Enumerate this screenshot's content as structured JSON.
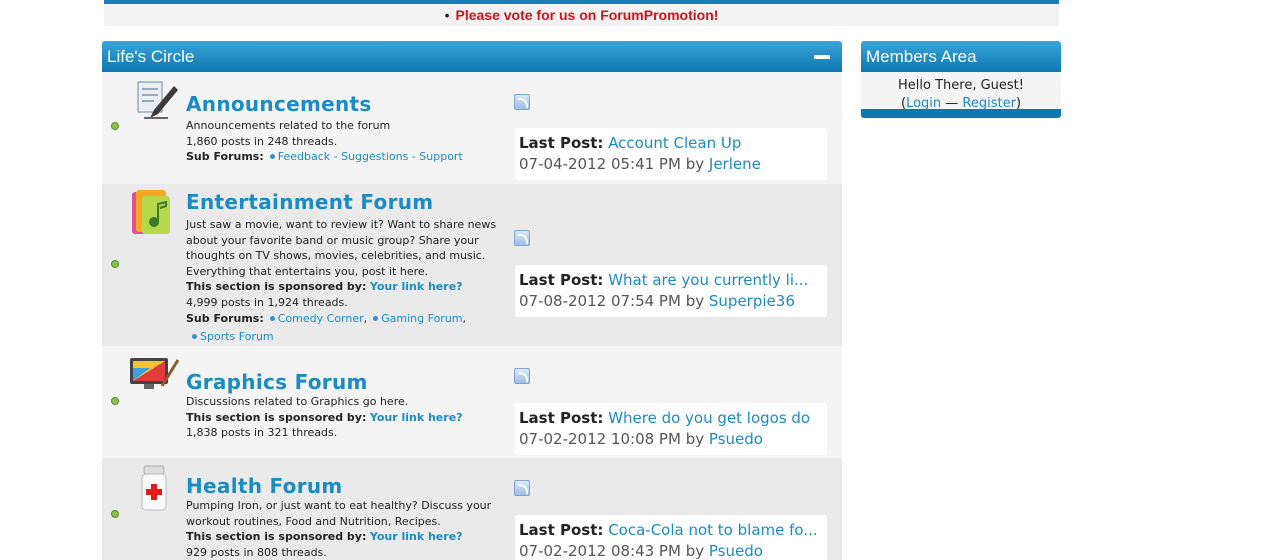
{
  "banner": {
    "bullet": "•",
    "text": "Please vote for us on ForumPromotion!"
  },
  "category": {
    "title": "Life's Circle"
  },
  "members": {
    "title": "Members Area",
    "greeting": "Hello There, Guest!",
    "open": "(",
    "login": "Login",
    "sep": " — ",
    "register": "Register",
    "close": ")"
  },
  "common": {
    "last_post_label": "Last Post:",
    "by": "by",
    "sponsored_label": "This section is sponsored by:",
    "sponsor_link": "Your link here?",
    "sub_forums_label": "Sub Forums:"
  },
  "forums": [
    {
      "title": "Announcements",
      "description": "Announcements related to the forum",
      "stats": "1,860 posts in 248 threads.",
      "sub_forums": "Feedback - Suggestions - Support",
      "last_post": {
        "title": "Account Clean Up",
        "date": "07-04-2012 05:41 PM",
        "author": "Jerlene"
      }
    },
    {
      "title": "Entertainment Forum",
      "description": "Just saw a movie, want to review it? Want to share news about your favorite band or music group? Share your thoughts on TV shows, movies, celebrities, and music. Everything that entertains you, post it here.",
      "stats": "4,999 posts in 1,924 threads.",
      "sub_forums": [
        "Comedy Corner",
        "Gaming Forum",
        "Sports Forum"
      ],
      "last_post": {
        "title": "What are you currently li...",
        "date": "07-08-2012 07:54 PM",
        "author": "Superpie36"
      }
    },
    {
      "title": "Graphics Forum",
      "description": "Discussions related to Graphics go here.",
      "stats": "1,838 posts in 321 threads.",
      "last_post": {
        "title": "Where do you get logos do",
        "date": "07-02-2012 10:08 PM",
        "author": "Psuedo"
      }
    },
    {
      "title": "Health Forum",
      "description": "Pumping Iron, or just want to eat healthy? Discuss your workout routines, Food and Nutrition, Recipes.",
      "stats": "929 posts in 808 threads.",
      "last_post": {
        "title": "Coca-Cola not to blame fo...",
        "date": "07-02-2012 08:43 PM",
        "author": "Psuedo"
      }
    }
  ]
}
